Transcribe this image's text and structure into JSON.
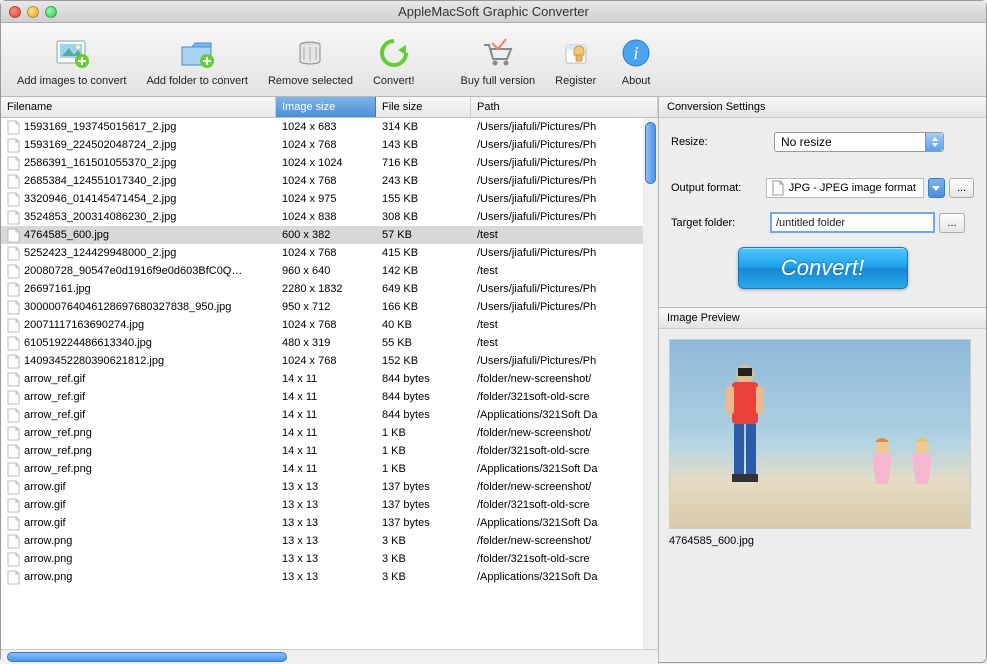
{
  "title": "AppleMacSoft Graphic Converter",
  "toolbar": {
    "add_images": "Add images to convert",
    "add_folder": "Add folder to convert",
    "remove": "Remove selected",
    "convert": "Convert!",
    "buy": "Buy full version",
    "register": "Register",
    "about": "About"
  },
  "columns": {
    "filename": "Filename",
    "image_size": "Image size",
    "file_size": "File size",
    "path": "Path"
  },
  "rows": [
    {
      "name": "1593169_193745015617_2.jpg",
      "size": "1024 x 683",
      "fsize": "314 KB",
      "path": "/Users/jiafuli/Pictures/Ph"
    },
    {
      "name": "1593169_224502048724_2.jpg",
      "size": "1024 x 768",
      "fsize": "143 KB",
      "path": "/Users/jiafuli/Pictures/Ph"
    },
    {
      "name": "2586391_161501055370_2.jpg",
      "size": "1024 x 1024",
      "fsize": "716 KB",
      "path": "/Users/jiafuli/Pictures/Ph"
    },
    {
      "name": "2685384_124551017340_2.jpg",
      "size": "1024 x 768",
      "fsize": "243 KB",
      "path": "/Users/jiafuli/Pictures/Ph"
    },
    {
      "name": "3320946_014145471454_2.jpg",
      "size": "1024 x 975",
      "fsize": "155 KB",
      "path": "/Users/jiafuli/Pictures/Ph"
    },
    {
      "name": "3524853_200314086230_2.jpg",
      "size": "1024 x 838",
      "fsize": "308 KB",
      "path": "/Users/jiafuli/Pictures/Ph"
    },
    {
      "name": "4764585_600.jpg",
      "size": "600 x 382",
      "fsize": "57 KB",
      "path": "/test",
      "selected": true
    },
    {
      "name": "5252423_124429948000_2.jpg",
      "size": "1024 x 768",
      "fsize": "415 KB",
      "path": "/Users/jiafuli/Pictures/Ph"
    },
    {
      "name": "20080728_90547e0d1916f9e0d603BfC0Q…",
      "size": "960 x 640",
      "fsize": "142 KB",
      "path": "/test"
    },
    {
      "name": "26697161.jpg",
      "size": "2280 x 1832",
      "fsize": "649 KB",
      "path": "/Users/jiafuli/Pictures/Ph"
    },
    {
      "name": "300000764046128697680327838_950.jpg",
      "size": "950 x 712",
      "fsize": "166 KB",
      "path": "/Users/jiafuli/Pictures/Ph"
    },
    {
      "name": "20071117163690274.jpg",
      "size": "1024 x 768",
      "fsize": "40 KB",
      "path": "/test"
    },
    {
      "name": "610519224486613340.jpg",
      "size": "480 x 319",
      "fsize": "55 KB",
      "path": "/test"
    },
    {
      "name": "1409345228039062​1812.jpg",
      "size": "1024 x 768",
      "fsize": "152 KB",
      "path": "/Users/jiafuli/Pictures/Ph"
    },
    {
      "name": "arrow_ref.gif",
      "size": "14 x 11",
      "fsize": "844 bytes",
      "path": "/folder/new-screenshot/"
    },
    {
      "name": "arrow_ref.gif",
      "size": "14 x 11",
      "fsize": "844 bytes",
      "path": "/folder/321soft-old-scre"
    },
    {
      "name": "arrow_ref.gif",
      "size": "14 x 11",
      "fsize": "844 bytes",
      "path": "/Applications/321Soft Da"
    },
    {
      "name": "arrow_ref.png",
      "size": "14 x 11",
      "fsize": "1 KB",
      "path": "/folder/new-screenshot/"
    },
    {
      "name": "arrow_ref.png",
      "size": "14 x 11",
      "fsize": "1 KB",
      "path": "/folder/321soft-old-scre"
    },
    {
      "name": "arrow_ref.png",
      "size": "14 x 11",
      "fsize": "1 KB",
      "path": "/Applications/321Soft Da"
    },
    {
      "name": "arrow.gif",
      "size": "13 x 13",
      "fsize": "137 bytes",
      "path": "/folder/new-screenshot/"
    },
    {
      "name": "arrow.gif",
      "size": "13 x 13",
      "fsize": "137 bytes",
      "path": "/folder/321soft-old-scre"
    },
    {
      "name": "arrow.gif",
      "size": "13 x 13",
      "fsize": "137 bytes",
      "path": "/Applications/321Soft Da"
    },
    {
      "name": "arrow.png",
      "size": "13 x 13",
      "fsize": "3 KB",
      "path": "/folder/new-screenshot/"
    },
    {
      "name": "arrow.png",
      "size": "13 x 13",
      "fsize": "3 KB",
      "path": "/folder/321soft-old-scre"
    },
    {
      "name": "arrow.png",
      "size": "13 x 13",
      "fsize": "3 KB",
      "path": "/Applications/321Soft Da"
    }
  ],
  "settings": {
    "heading": "Conversion Settings",
    "resize_label": "Resize:",
    "resize_value": "No resize",
    "output_label": "Output format:",
    "output_value": "JPG - JPEG image format",
    "target_label": "Target folder:",
    "target_value": "/untitled folder",
    "convert_button": "Convert!",
    "ellipsis": "..."
  },
  "preview": {
    "heading": "Image Preview",
    "filename": "4764585_600.jpg"
  }
}
